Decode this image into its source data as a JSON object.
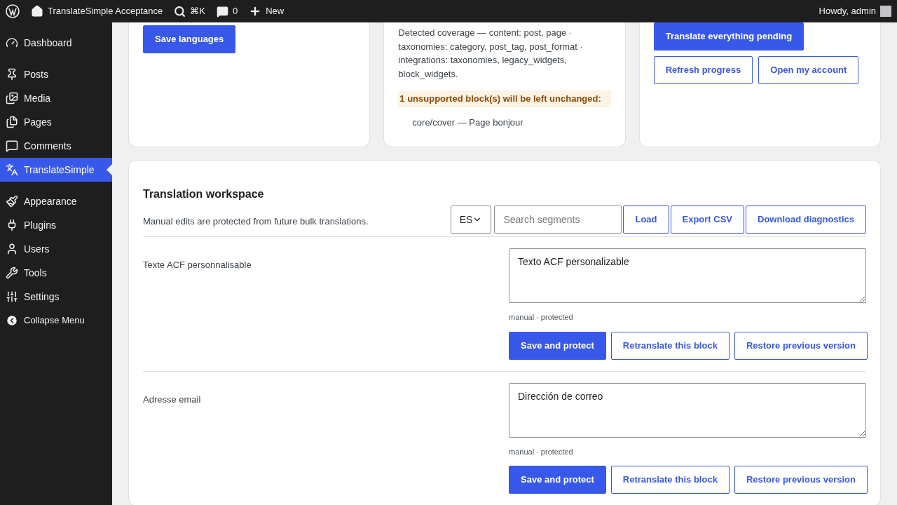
{
  "admin_bar": {
    "site_title": "TranslateSimple Acceptance",
    "search_shortcut": "⌘K",
    "comments_count": "0",
    "new_label": "New",
    "greeting": "Howdy, admin"
  },
  "sidebar": {
    "groups": [
      [
        {
          "label": "Dashboard",
          "selected": false,
          "kind": "item"
        }
      ],
      [
        {
          "label": "Posts",
          "selected": false,
          "kind": "item"
        },
        {
          "label": "Media",
          "selected": false,
          "kind": "item"
        },
        {
          "label": "Pages",
          "selected": false,
          "kind": "item"
        },
        {
          "label": "Comments",
          "selected": false,
          "kind": "item"
        },
        {
          "label": "TranslateSimple",
          "selected": true,
          "kind": "item"
        }
      ],
      [
        {
          "label": "Appearance",
          "selected": false,
          "kind": "item"
        },
        {
          "label": "Plugins",
          "selected": false,
          "kind": "item"
        },
        {
          "label": "Users",
          "selected": false,
          "kind": "item"
        },
        {
          "label": "Tools",
          "selected": false,
          "kind": "item"
        },
        {
          "label": "Settings",
          "selected": false,
          "kind": "item"
        },
        {
          "label": "Collapse Menu",
          "selected": false,
          "kind": "collapse"
        }
      ]
    ]
  },
  "languages_card": {
    "save_button": "Save languages"
  },
  "coverage_card": {
    "coverage_text": "Detected coverage — content: post, page · taxonomies: category, post_tag, post_format · integrations: taxonomies, legacy_widgets, block_widgets.",
    "warning": "1 unsupported block(s) will be left unchanged:",
    "unsupported_blocks": [
      "core/cover — Page bonjour"
    ]
  },
  "actions_card": {
    "buttons": [
      {
        "label": "Translate everything pending",
        "kind": "primary"
      },
      {
        "label": "Refresh progress",
        "kind": "secondary"
      },
      {
        "label": "Open my account",
        "kind": "secondary"
      }
    ]
  },
  "workspace": {
    "title": "Translation workspace",
    "description": "Manual edits are protected from future bulk translations.",
    "language_select": "ES",
    "search": {
      "placeholder": "Search segments"
    },
    "buttons": [
      "Load",
      "Export CSV",
      "Download diagnostics"
    ],
    "segments": [
      {
        "source": "Texte ACF personnalisable",
        "translation": "Texto ACF personalizable",
        "meta": "manual · protected",
        "buttons": [
          {
            "label": "Save and protect",
            "kind": "primary"
          },
          {
            "label": "Retranslate this block",
            "kind": "secondary"
          },
          {
            "label": "Restore previous version",
            "kind": "secondary"
          }
        ]
      },
      {
        "source": "Adresse email",
        "translation": "Dirección de correo",
        "meta": "manual · protected",
        "buttons": [
          {
            "label": "Save and protect",
            "kind": "primary"
          },
          {
            "label": "Retranslate this block",
            "kind": "secondary"
          },
          {
            "label": "Restore previous version",
            "kind": "secondary"
          }
        ]
      }
    ]
  }
}
